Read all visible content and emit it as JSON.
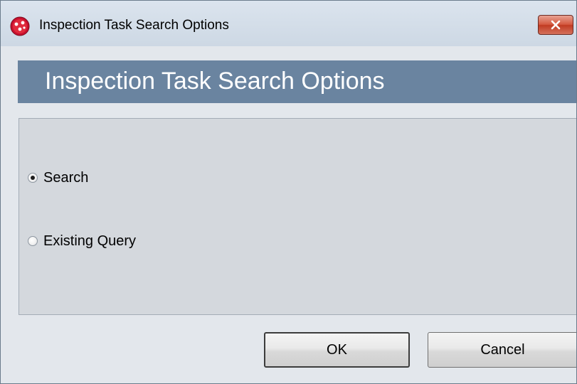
{
  "window": {
    "title": "Inspection Task Search Options",
    "app_icon": "red-molecule-icon",
    "close_icon": "close-x-icon"
  },
  "header": {
    "title": "Inspection Task Search Options",
    "background_color": "#6a84a0"
  },
  "options": [
    {
      "label": "Search",
      "selected": true
    },
    {
      "label": "Existing Query",
      "selected": false
    }
  ],
  "buttons": {
    "ok_label": "OK",
    "cancel_label": "Cancel"
  },
  "colors": {
    "close_button": "#d4583f",
    "panel_bg": "#d4d8dd",
    "window_bg": "#e3e7ec"
  }
}
